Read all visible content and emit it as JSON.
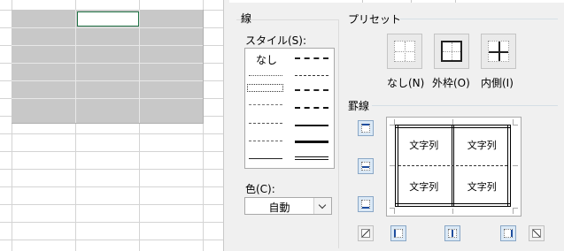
{
  "dialog": {
    "line_group": {
      "title": "線",
      "style_label": "スタイル(S):",
      "style_none": "なし",
      "color_label": "色(C):",
      "color_value": "自動"
    },
    "preset_group": {
      "title": "プリセット",
      "presets": [
        {
          "label": "なし(N)",
          "icon": "preset-none-icon"
        },
        {
          "label": "外枠(O)",
          "icon": "preset-outline-icon"
        },
        {
          "label": "内側(I)",
          "icon": "preset-inside-icon"
        }
      ]
    },
    "border_group": {
      "title": "罫線",
      "preview_cells": [
        "文字列",
        "文字列",
        "文字列",
        "文字列"
      ]
    }
  },
  "colors": {
    "dialog_bg": "#f0f0f0",
    "selection_fill": "#c8c8c8",
    "active_cell_border": "#217346",
    "border_button_active": "#dbe9f6"
  }
}
